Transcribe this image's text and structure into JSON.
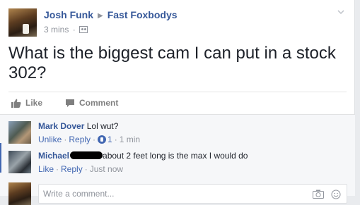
{
  "post": {
    "author": "Josh Funk",
    "group": "Fast Foxbodys",
    "time": "3 mins",
    "text": "What is the biggest cam I can put in a stock 302?"
  },
  "actions": {
    "like_label": "Like",
    "comment_label": "Comment"
  },
  "comments": [
    {
      "name": "Mark Dover",
      "text": "Lol wut?",
      "action_1": "Unlike",
      "action_2": "Reply",
      "likes": "1",
      "time": "1 min"
    },
    {
      "name": "Michael",
      "text": "about 2 feet long is the max I would do",
      "action_1": "Like",
      "action_2": "Reply",
      "time": "Just now"
    }
  ],
  "composer": {
    "placeholder": "Write a comment..."
  },
  "colors": {
    "link": "#365899",
    "muted": "#90949c",
    "accent": "#4267b2"
  }
}
